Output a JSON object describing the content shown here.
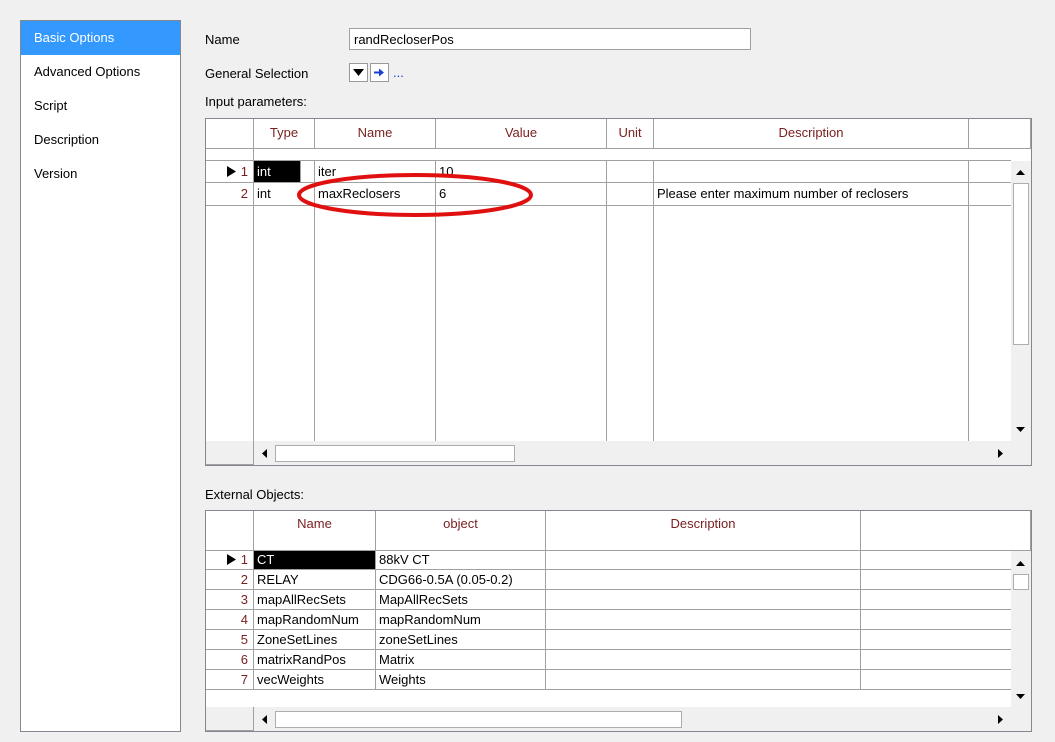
{
  "nav": {
    "items": [
      {
        "label": "Basic Options",
        "selected": true
      },
      {
        "label": "Advanced Options"
      },
      {
        "label": "Script"
      },
      {
        "label": "Description"
      },
      {
        "label": "Version"
      }
    ]
  },
  "form": {
    "name_label": "Name",
    "name_value": "randRecloserPos",
    "general_selection_label": "General Selection",
    "ellipsis": "...",
    "input_params_label": "Input parameters:",
    "external_objects_label": "External Objects:"
  },
  "input_params": {
    "columns": [
      "Type",
      "Name",
      "Value",
      "Unit",
      "Description"
    ],
    "rows": [
      {
        "num": "1",
        "type": "int",
        "name": "iter",
        "value": "10",
        "unit": "",
        "description": ""
      },
      {
        "num": "2",
        "type": "int",
        "name": "maxReclosers",
        "value": "6",
        "unit": "",
        "description": "Please enter maximum number of reclosers"
      }
    ]
  },
  "external_objects": {
    "columns": [
      "Name",
      "object",
      "Description"
    ],
    "rows": [
      {
        "num": "1",
        "name": "CT",
        "object": "88kV CT",
        "description": ""
      },
      {
        "num": "2",
        "name": "RELAY",
        "object": "CDG66-0.5A (0.05-0.2)",
        "description": ""
      },
      {
        "num": "3",
        "name": "mapAllRecSets",
        "object": "MapAllRecSets",
        "description": ""
      },
      {
        "num": "4",
        "name": "mapRandomNum",
        "object": "mapRandomNum",
        "description": ""
      },
      {
        "num": "5",
        "name": "ZoneSetLines",
        "object": "zoneSetLines",
        "description": ""
      },
      {
        "num": "6",
        "name": "matrixRandPos",
        "object": "Matrix",
        "description": ""
      },
      {
        "num": "7",
        "name": "vecWeights",
        "object": "Weights",
        "description": ""
      }
    ]
  },
  "colors": {
    "accent": "#3399ff",
    "header_text": "#7a1e1e",
    "annotation": "#e01010",
    "arrow_blue": "#1a3fd6"
  },
  "icons": [
    "dropdown-arrow-icon",
    "select-arrow-icon",
    "row-pointer-icon",
    "scroll-arrow-icon"
  ]
}
